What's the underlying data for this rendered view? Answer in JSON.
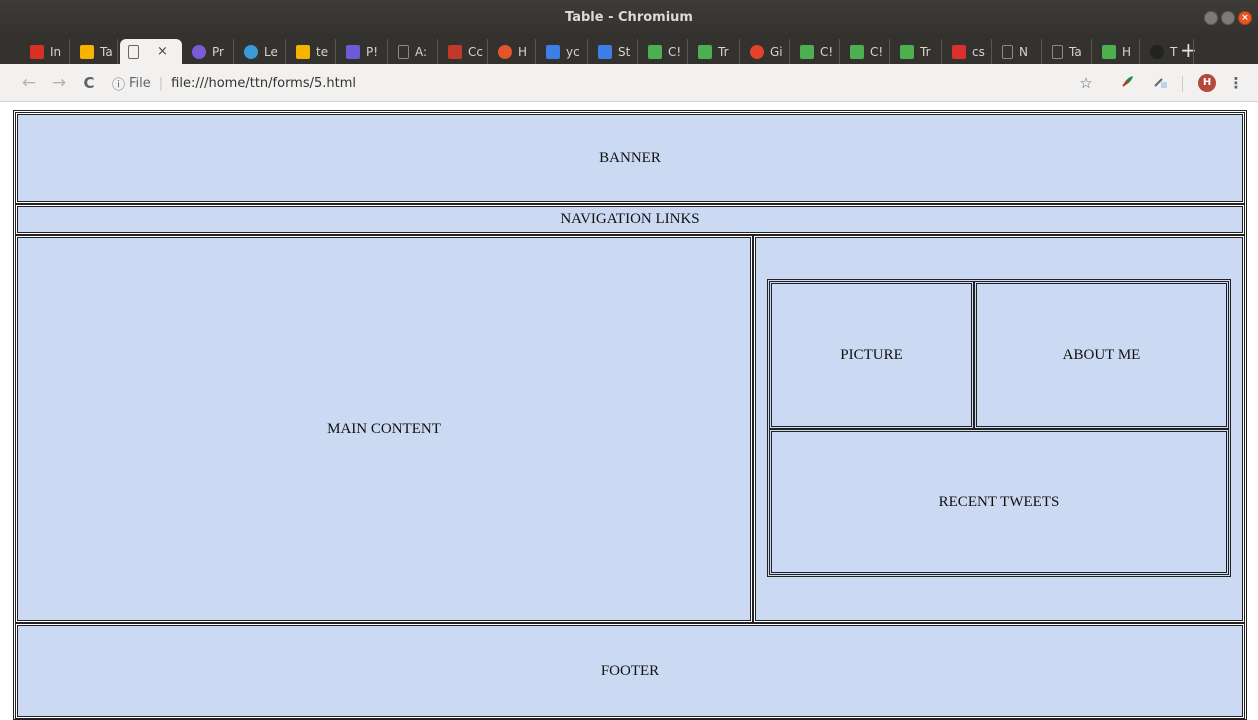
{
  "window": {
    "title": "Table - Chromium",
    "close_glyph": "×"
  },
  "tabs": [
    {
      "label": "In",
      "icon": "gmail-icon",
      "color": "#d93025"
    },
    {
      "label": "Ta",
      "icon": "keep-icon",
      "color": "#f6b400"
    },
    {
      "label": "",
      "icon": "page-icon",
      "color": "#ffffff",
      "active": true
    },
    {
      "label": "Pr",
      "icon": "color-wheel-icon",
      "color": "#7b5cd6"
    },
    {
      "label": "Le",
      "icon": "color-wheel-icon",
      "color": "#3a9bd9"
    },
    {
      "label": "te",
      "icon": "keep-icon",
      "color": "#f6b400"
    },
    {
      "label": "P!",
      "icon": "link-icon",
      "color": "#6b5bd6"
    },
    {
      "label": "A:",
      "icon": "page-icon",
      "color": "#666"
    },
    {
      "label": "Cc",
      "icon": "store-icon",
      "color": "#c0392b"
    },
    {
      "label": "H",
      "icon": "chrome-color-icon",
      "color": "#e6542c"
    },
    {
      "label": "yc",
      "icon": "flag-icon",
      "color": "#3d7fe6"
    },
    {
      "label": "St",
      "icon": "flag-icon",
      "color": "#3d7fe6"
    },
    {
      "label": "C!",
      "icon": "w3-icon",
      "color": "#4caf50"
    },
    {
      "label": "Tr",
      "icon": "w3-icon",
      "color": "#4caf50"
    },
    {
      "label": "Gi",
      "icon": "gitlab-icon",
      "color": "#e24329"
    },
    {
      "label": "C!",
      "icon": "w3-icon",
      "color": "#4caf50"
    },
    {
      "label": "C!",
      "icon": "w3-icon",
      "color": "#4caf50"
    },
    {
      "label": "Tr",
      "icon": "w3-icon",
      "color": "#4caf50"
    },
    {
      "label": "cs",
      "icon": "mountain-icon",
      "color": "#d9302b"
    },
    {
      "label": "N",
      "icon": "page-icon",
      "color": "#666"
    },
    {
      "label": "Ta",
      "icon": "page-icon",
      "color": "#666"
    },
    {
      "label": "H",
      "icon": "w3-icon",
      "color": "#4caf50"
    },
    {
      "label": "T",
      "icon": "github-icon",
      "color": "#222"
    }
  ],
  "active_tab_close": "×",
  "new_tab_label": "+",
  "toolbar": {
    "back": "←",
    "forward": "→",
    "reload": "C",
    "info_glyph": "ⓘ",
    "scheme": "File",
    "url": "file:///home/ttn/forms/5.html",
    "star": "☆",
    "avatar_letter": "H",
    "menu": "⋮"
  },
  "layout_table": {
    "banner": "BANNER",
    "navigation": "NAVIGATION LINKS",
    "main_content": "MAIN CONTENT",
    "picture": "PICTURE",
    "about_me": "ABOUT ME",
    "recent_tweets": "RECENT TWEETS",
    "footer": "FOOTER"
  },
  "colors": {
    "cell_background": "#ccd9f2",
    "cell_border": "#222222",
    "chrome_frame": "#33322e"
  }
}
